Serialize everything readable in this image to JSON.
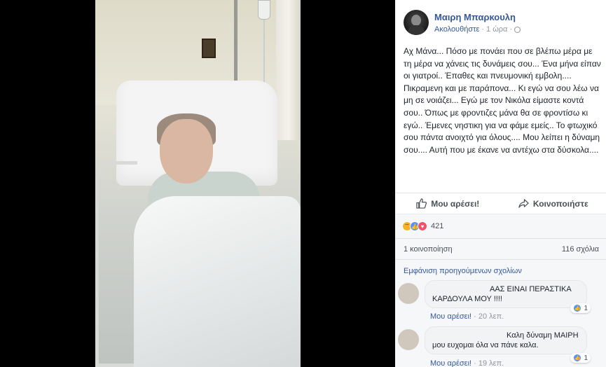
{
  "post": {
    "author": "Μαιρη Μπαρκουλη",
    "follow_label": "Ακολουθήστε",
    "time": "1 ώρα",
    "text": "Αχ Μάνα... Πόσο με πονάει που σε βλέπω μέρα με τη μέρα να χάνεις τις δυνάμεις σου... Ένα μήνα είπαν οι γιατροί.. Έπαθες και πνευμονική εμβολη.... Πικραμενη και με παράπονα... Κι εγώ να σου λέω να μη σε νοιάζει... Εγώ με τον Νικόλα είμαστε κοντά σου.. Όπως με φροντιζες μάνα θα σε φροντίσω κι εγώ.. Έμενες νηστικη για να φάμε εμείς.. Το φτωχικό σου πάντα ανοιχτό για όλους.... Μου λείπει η δύναμη σου.... Αυτή που με έκανε να αντέχω στα δύσκολα...."
  },
  "actions": {
    "like_label": "Μου αρέσει!",
    "share_label": "Κοινοποιήστε"
  },
  "stats": {
    "reaction_count": "421",
    "shares": "1 κοινοποίηση",
    "comments": "116 σχόλια",
    "prev_comments": "Εμφάνιση προηγούμενων σχολίων"
  },
  "comments": [
    {
      "line1": "ΑΑΣ ΕΙΝΑΙ ΠΕΡΑΣΤΙΚΑ",
      "line2": "ΚΑΡΔΟΥΛΑ ΜΟΥ !!!!",
      "likes": "1",
      "like_label": "Μου αρέσει!",
      "time": "20 λεπ."
    },
    {
      "line1": "Καλη δύναμη ΜΑΙΡΗ",
      "line2": "μου ευχομαι όλα να πάνε καλα.",
      "likes": "1",
      "like_label": "Μου αρέσει!",
      "time": "19 λεπ."
    }
  ],
  "colors": {
    "link": "#365899",
    "muted": "#90949c",
    "text": "#1d2129",
    "like": "#5890ff",
    "love": "#f25268",
    "sad": "#f7b125"
  }
}
